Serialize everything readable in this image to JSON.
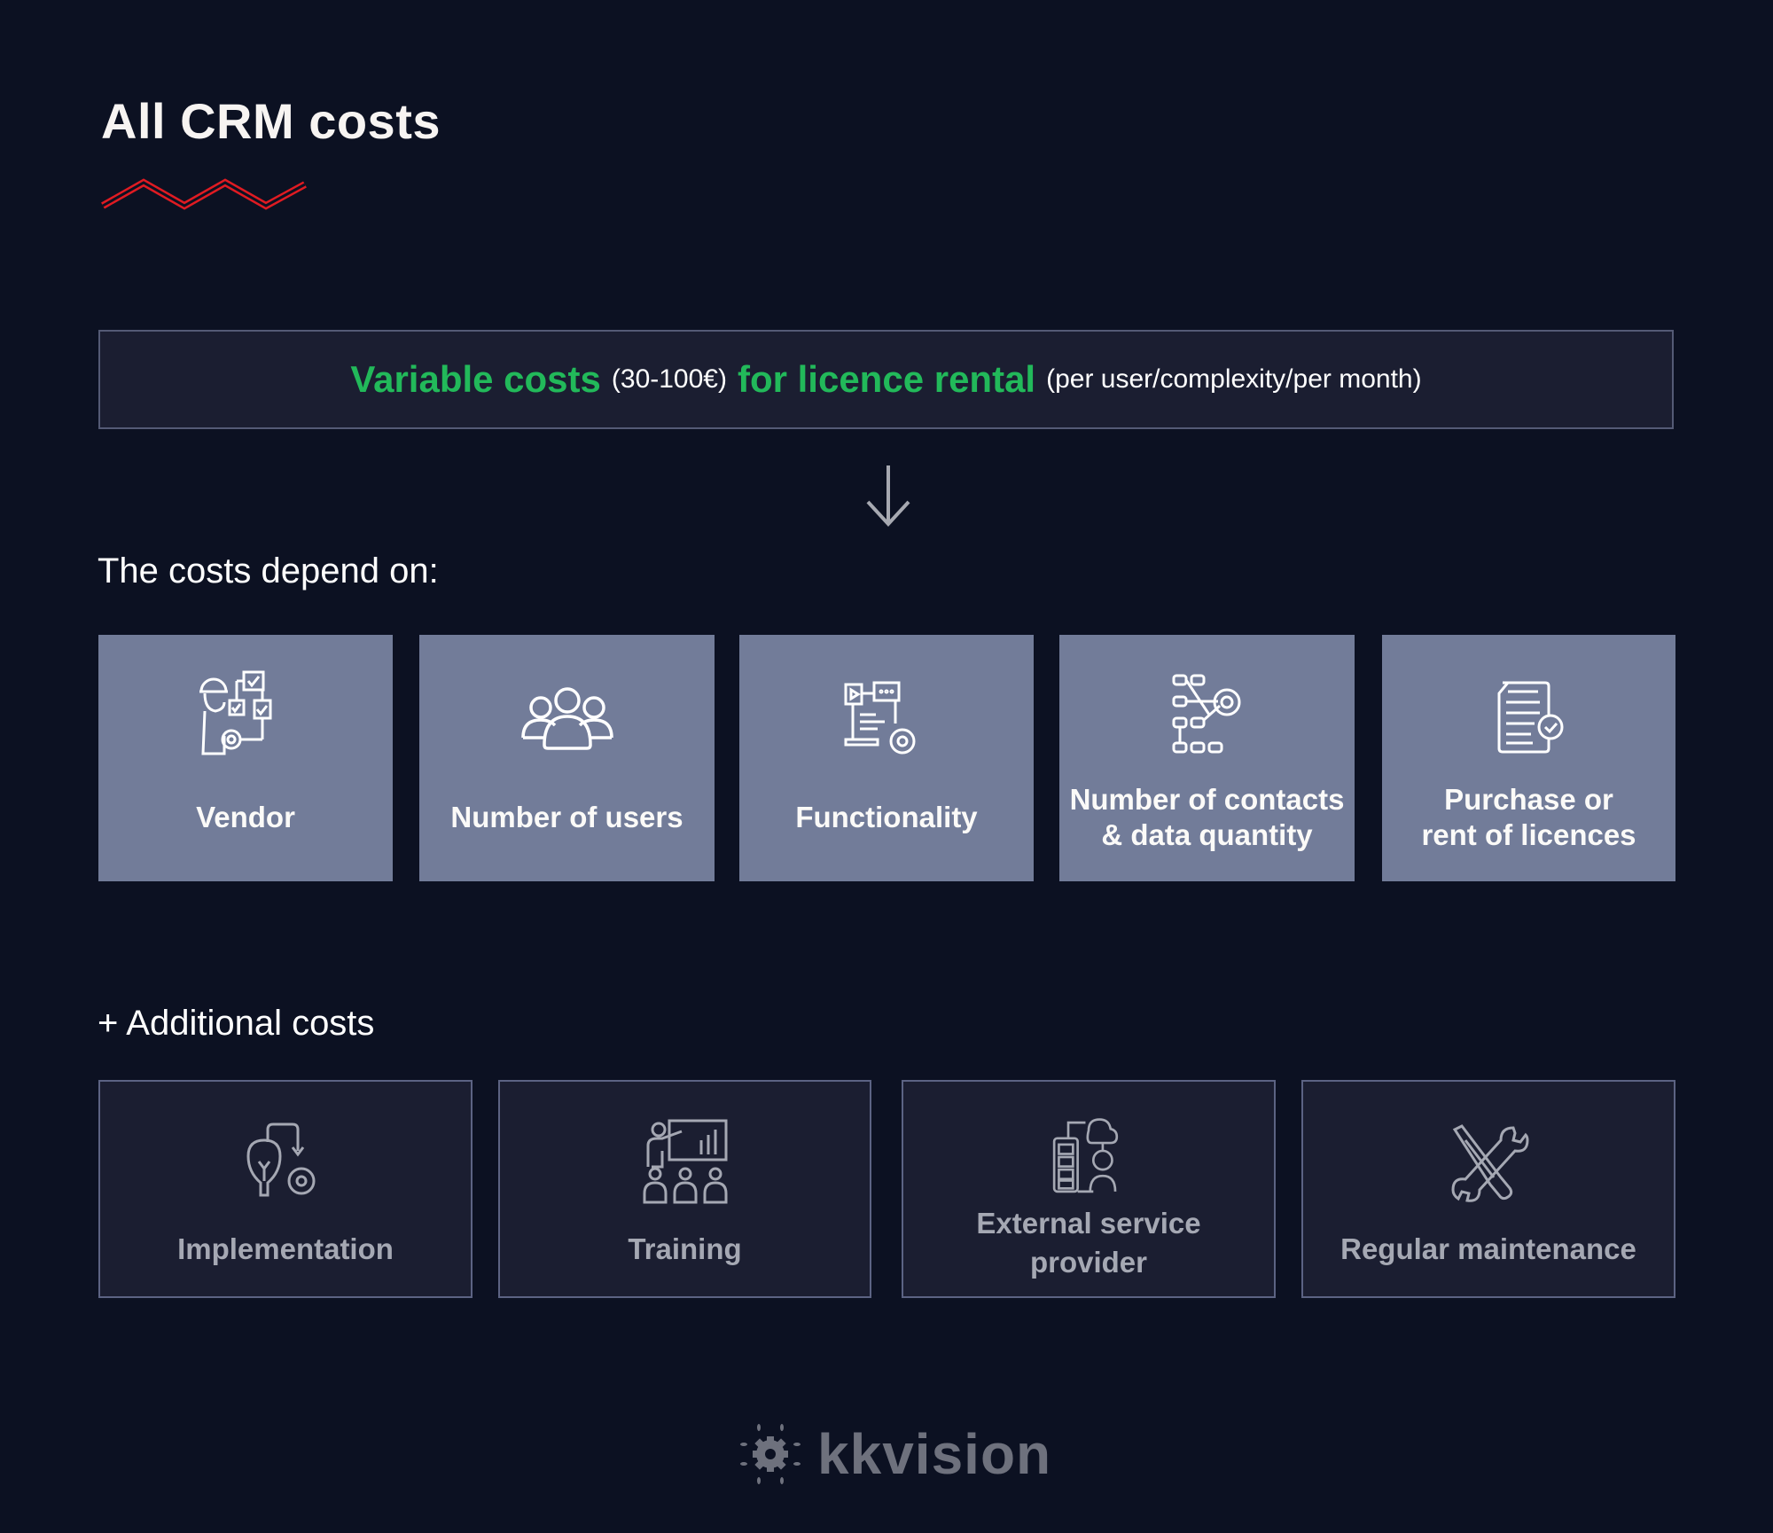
{
  "title": "All CRM costs",
  "colors": {
    "background": "#0c1122",
    "accent_red": "#e01b22",
    "accent_green": "#22b95a",
    "card_primary": "#727c99",
    "card_secondary": "#1b1e31"
  },
  "banner": {
    "part1": "Variable costs",
    "part2": "(30-100€)",
    "part3": "for licence rental",
    "part4": "(per user/complexity/per month)"
  },
  "arrow_icon": "arrow-down-icon",
  "depends": {
    "heading": "The costs depend on:",
    "cards": [
      {
        "label": "Vendor",
        "icon": "worker-workflow-icon"
      },
      {
        "label": "Number of users",
        "icon": "users-group-icon"
      },
      {
        "label": "Functionality",
        "icon": "functionality-gear-icon"
      },
      {
        "label_line1": "Number of contacts",
        "label_line2": "& data quantity",
        "icon": "data-network-gear-icon"
      },
      {
        "label_line1": "Purchase or",
        "label_line2": "rent of licences",
        "icon": "licence-document-icon"
      }
    ]
  },
  "additional": {
    "heading": "+ Additional costs",
    "cards": [
      {
        "label": "Implementation",
        "icon": "lightbulb-gear-icon"
      },
      {
        "label": "Training",
        "icon": "presentation-training-icon"
      },
      {
        "label_line1": "External service",
        "label_line2": "provider",
        "icon": "server-cloud-person-icon"
      },
      {
        "label": "Regular maintenance",
        "icon": "wrench-screwdriver-icon"
      }
    ]
  },
  "logo": {
    "name": "kkvision",
    "icon": "gear-sun-logo-icon"
  }
}
